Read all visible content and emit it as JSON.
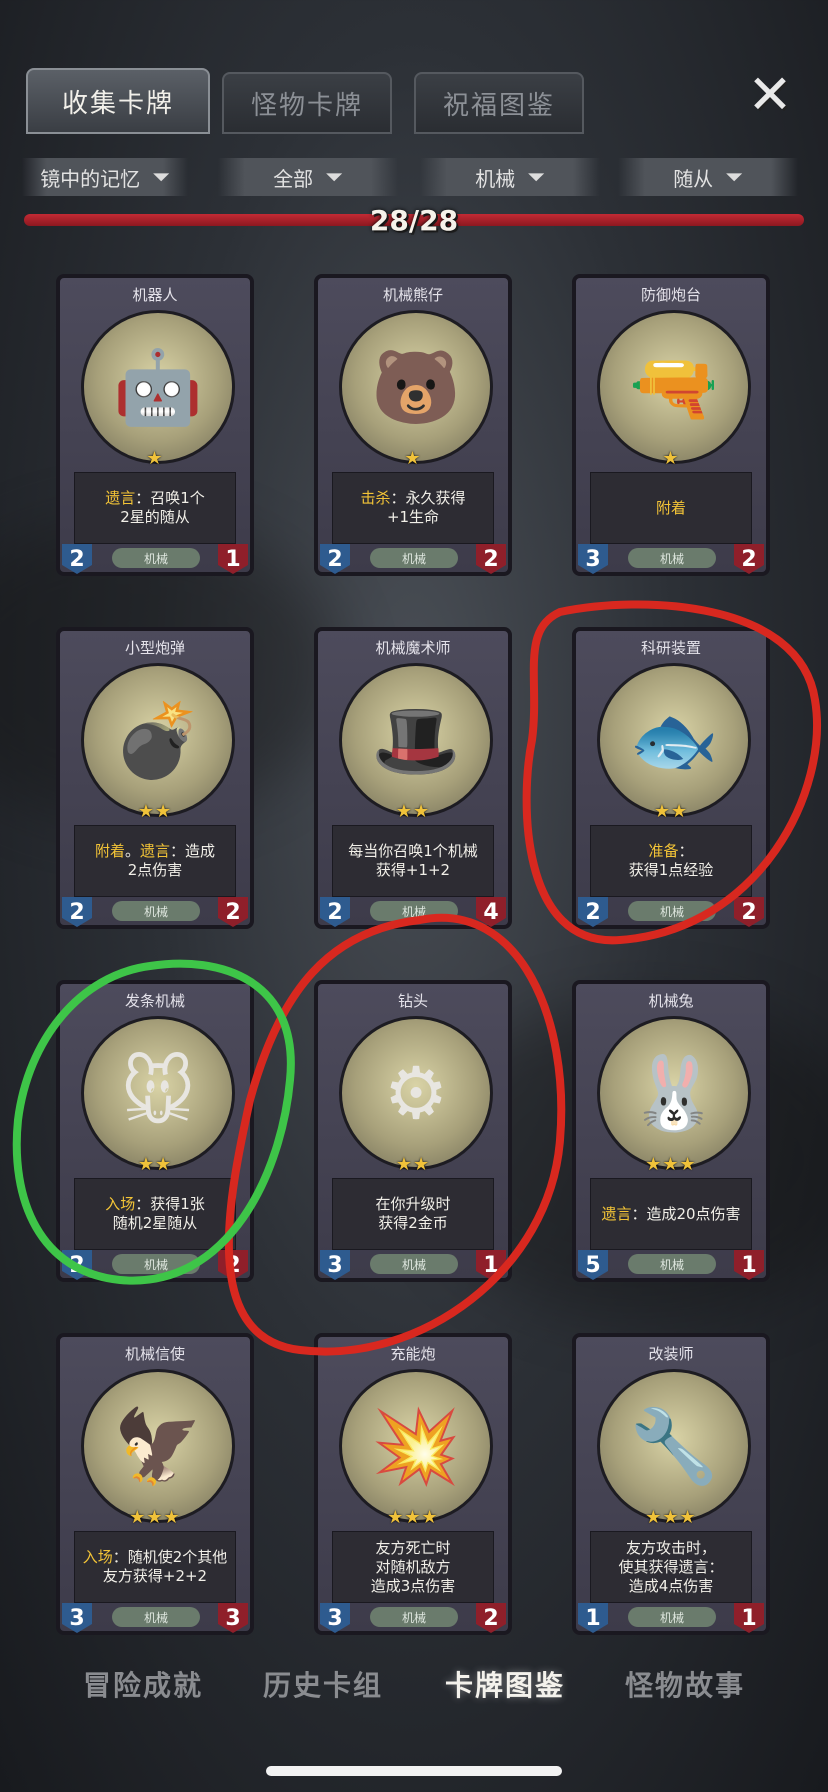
{
  "tabs": [
    {
      "label": "收集卡牌",
      "active": true
    },
    {
      "label": "怪物卡牌",
      "active": false
    },
    {
      "label": "祝福图鉴",
      "active": false
    }
  ],
  "filters": [
    {
      "label": "镜中的记忆"
    },
    {
      "label": "全部"
    },
    {
      "label": "机械"
    },
    {
      "label": "随从"
    }
  ],
  "progress": {
    "text": "28/28",
    "value": 1.0
  },
  "cards": [
    {
      "name": "机器人",
      "stars": "★",
      "desc1": [
        {
          "t": "遗言",
          "k": true
        },
        {
          "t": "：召唤1个",
          "k": false
        }
      ],
      "desc2": "2星的随从",
      "cost": "2",
      "hp": "1",
      "tribe": "机械",
      "icon": "robot-icon",
      "emoji": "🤖"
    },
    {
      "name": "机械熊仔",
      "stars": "★",
      "desc1": [
        {
          "t": "击杀",
          "k": true
        },
        {
          "t": "：永久获得",
          "k": false
        }
      ],
      "desc2": "+1生命",
      "cost": "2",
      "hp": "2",
      "tribe": "机械",
      "icon": "bear-icon",
      "emoji": "🐻"
    },
    {
      "name": "防御炮台",
      "stars": "★",
      "desc1": [
        {
          "t": "附着",
          "k": true
        }
      ],
      "desc2": "",
      "cost": "3",
      "hp": "2",
      "tribe": "机械",
      "icon": "turret-icon",
      "emoji": "🔫"
    },
    {
      "name": "小型炮弹",
      "stars": "★★",
      "desc1": [
        {
          "t": "附着",
          "k": true
        },
        {
          "t": "。",
          "k": false
        },
        {
          "t": "遗言",
          "k": true
        },
        {
          "t": "：造成",
          "k": false
        }
      ],
      "desc2": "2点伤害",
      "cost": "2",
      "hp": "2",
      "tribe": "机械",
      "icon": "bomb-icon",
      "emoji": "💣"
    },
    {
      "name": "机械魔术师",
      "stars": "★★",
      "desc1": [
        {
          "t": "每当你召唤1个机械",
          "k": false
        }
      ],
      "desc2": "获得+1+2",
      "cost": "2",
      "hp": "4",
      "tribe": "机械",
      "icon": "magician-icon",
      "emoji": "🎩"
    },
    {
      "name": "科研装置",
      "stars": "★★",
      "desc1": [
        {
          "t": "准备",
          "k": true
        },
        {
          "t": "：",
          "k": false
        }
      ],
      "desc2": "获得1点经验",
      "cost": "2",
      "hp": "2",
      "tribe": "机械",
      "icon": "fish-tank-icon",
      "emoji": "🐟"
    },
    {
      "name": "发条机械",
      "stars": "★★",
      "desc1": [
        {
          "t": "入场",
          "k": true
        },
        {
          "t": "：获得1张",
          "k": false
        }
      ],
      "desc2": "随机2星随从",
      "cost": "2",
      "hp": "2",
      "tribe": "机械",
      "icon": "windup-mouse-icon",
      "emoji": "🐭"
    },
    {
      "name": "钻头",
      "stars": "★★",
      "desc1": [
        {
          "t": "在你升级时",
          "k": false
        }
      ],
      "desc2": "获得2金币",
      "cost": "3",
      "hp": "1",
      "tribe": "机械",
      "icon": "drill-icon",
      "emoji": "⚙"
    },
    {
      "name": "机械兔",
      "stars": "★★★",
      "desc1": [
        {
          "t": "遗言",
          "k": true
        },
        {
          "t": "：造成20点伤害",
          "k": false
        }
      ],
      "desc2": "",
      "cost": "5",
      "hp": "1",
      "tribe": "机械",
      "icon": "rabbit-icon",
      "emoji": "🐰"
    },
    {
      "name": "机械信使",
      "stars": "★★★",
      "desc1": [
        {
          "t": "入场",
          "k": true
        },
        {
          "t": "：随机使2个其他",
          "k": false
        }
      ],
      "desc2": "友方获得+2+2",
      "cost": "3",
      "hp": "3",
      "tribe": "机械",
      "icon": "bird-icon",
      "emoji": "🦅"
    },
    {
      "name": "充能炮",
      "stars": "★★★",
      "desc1": [
        {
          "t": "友方死亡时",
          "k": false
        }
      ],
      "desc2": "对随机敌方",
      "desc3": "造成3点伤害",
      "cost": "3",
      "hp": "2",
      "tribe": "机械",
      "icon": "cannon-icon",
      "emoji": "💥"
    },
    {
      "name": "改装师",
      "stars": "★★★",
      "desc1": [
        {
          "t": "友方攻击时，",
          "k": false
        }
      ],
      "desc2": "使其获得遗言：",
      "desc3": "造成4点伤害",
      "cost": "1",
      "hp": "1",
      "tribe": "机械",
      "icon": "mechanic-icon",
      "emoji": "🔧"
    }
  ],
  "bottom_nav": [
    {
      "label": "冒险成就",
      "active": false
    },
    {
      "label": "历史卡组",
      "active": false
    },
    {
      "label": "卡牌图鉴",
      "active": true
    },
    {
      "label": "怪物故事",
      "active": false
    }
  ],
  "colors": {
    "keyword": "#f3c437",
    "progress": "#c32a34",
    "red_circle": "#d8281f",
    "green_circle": "#3ec548"
  }
}
